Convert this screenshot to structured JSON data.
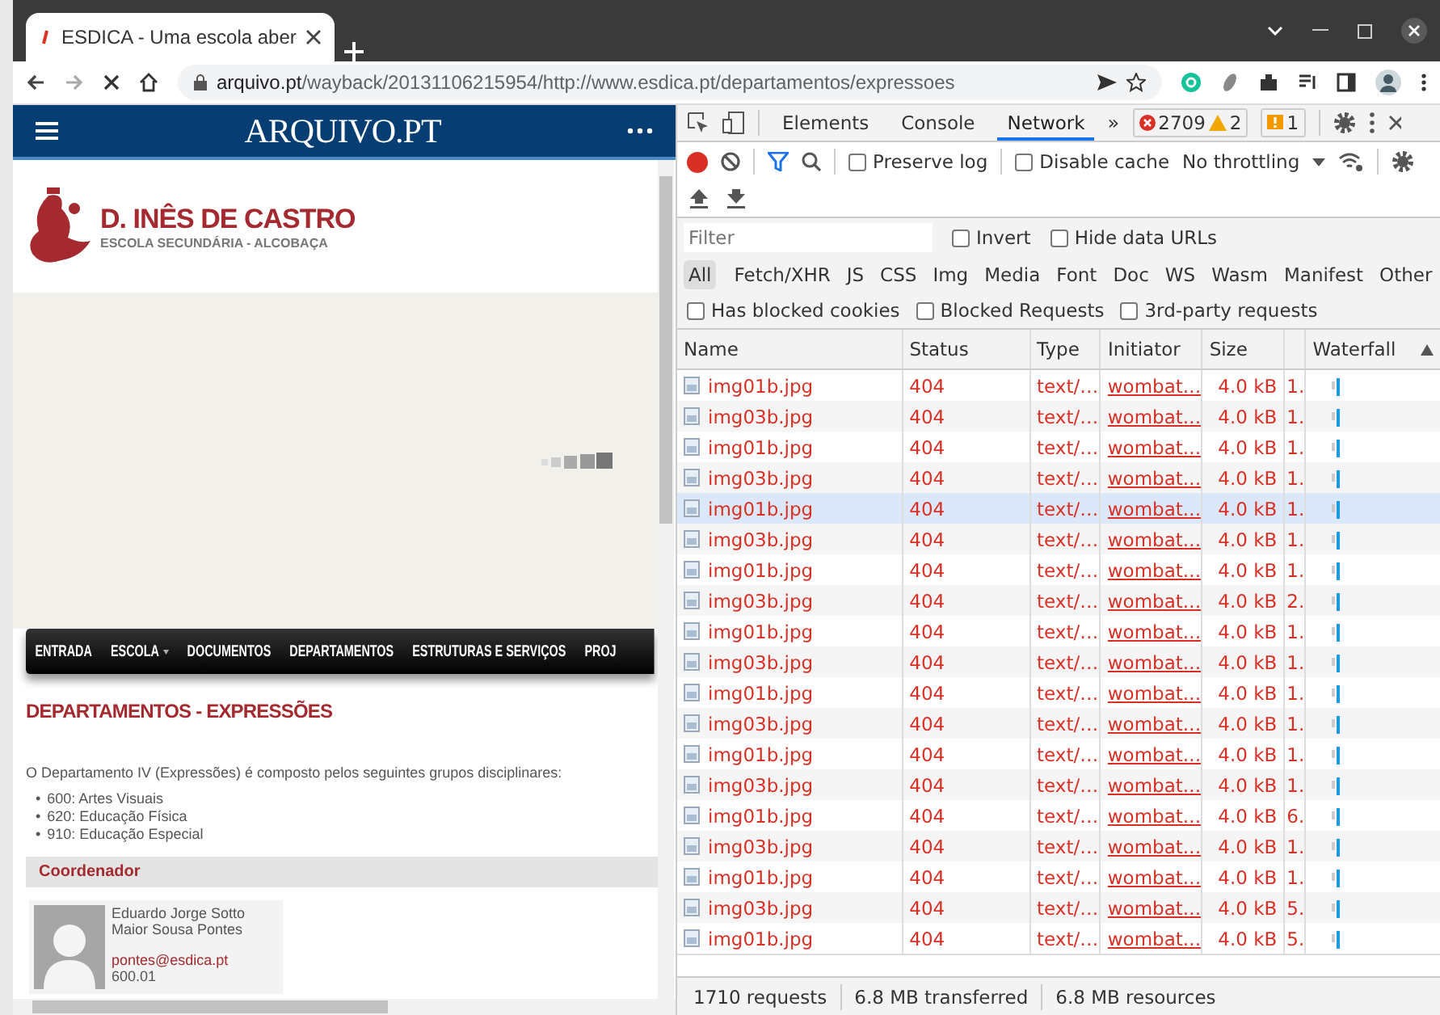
{
  "browser": {
    "tab": {
      "title": "ESDICA - Uma escola aber"
    },
    "url": {
      "host": "arquivo.pt",
      "path": "/wayback/20131106215954/http://www.esdica.pt/departamentos/expressoes"
    }
  },
  "page": {
    "banner": {
      "title": "ARQUIVO.PT"
    },
    "school": {
      "name": "D. INÊS DE CASTRO",
      "subtitle": "ESCOLA SECUNDÁRIA - ALCOBAÇA"
    },
    "nav": [
      {
        "label": "ENTRADA",
        "dropdown": false
      },
      {
        "label": "ESCOLA",
        "dropdown": true
      },
      {
        "label": "DOCUMENTOS",
        "dropdown": false
      },
      {
        "label": "DEPARTAMENTOS",
        "dropdown": false
      },
      {
        "label": "ESTRUTURAS E SERVIÇOS",
        "dropdown": false
      },
      {
        "label": "PROJ",
        "dropdown": false
      }
    ],
    "heading": "DEPARTAMENTOS - EXPRESSÕES",
    "intro": "O Departamento IV (Expressões) é composto pelos seguintes grupos disciplinares:",
    "groups": [
      {
        "marker": "•",
        "text": "600: Artes Visuais"
      },
      {
        "marker": "•",
        "text": "620: Educação Física"
      },
      {
        "marker": "•",
        "text": "910: Educação Especial"
      }
    ],
    "section": "Coordenador",
    "coordinator": {
      "name": "Eduardo Jorge Sotto Maior Sousa Pontes",
      "email": "pontes@esdica.pt",
      "code": "600.01"
    }
  },
  "devtools": {
    "tabs": [
      {
        "label": "Elements",
        "selected": false
      },
      {
        "label": "Console",
        "selected": false
      },
      {
        "label": "Network",
        "selected": true
      }
    ],
    "more": "»",
    "errors": "2709",
    "warnings": "2",
    "issues": "1",
    "options": [
      {
        "label": "Preserve log",
        "checked": false
      },
      {
        "label": "Disable cache",
        "checked": false
      }
    ],
    "throttling": "No throttling",
    "filter": {
      "placeholder": "Filter"
    },
    "filter_options": [
      {
        "label": "Invert",
        "checked": false
      },
      {
        "label": "Hide data URLs",
        "checked": false
      }
    ],
    "types": [
      {
        "label": "All",
        "selected": true
      },
      {
        "label": "Fetch/XHR",
        "selected": false
      },
      {
        "label": "JS",
        "selected": false
      },
      {
        "label": "CSS",
        "selected": false
      },
      {
        "label": "Img",
        "selected": false
      },
      {
        "label": "Media",
        "selected": false
      },
      {
        "label": "Font",
        "selected": false
      },
      {
        "label": "Doc",
        "selected": false
      },
      {
        "label": "WS",
        "selected": false
      },
      {
        "label": "Wasm",
        "selected": false
      },
      {
        "label": "Manifest",
        "selected": false
      },
      {
        "label": "Other",
        "selected": false
      }
    ],
    "blocking": [
      {
        "label": "Has blocked cookies",
        "checked": false
      },
      {
        "label": "Blocked Requests",
        "checked": false
      },
      {
        "label": "3rd-party requests",
        "checked": false
      }
    ],
    "columns": [
      "Name",
      "Status",
      "Type",
      "Initiator",
      "Size",
      "Waterfall"
    ],
    "rows": [
      {
        "name": "img01b.jpg",
        "status": "404",
        "type": "text/…",
        "initiator": "wombat.…",
        "size": "4.0 kB",
        "time": "1.",
        "highlighted": false
      },
      {
        "name": "img03b.jpg",
        "status": "404",
        "type": "text/…",
        "initiator": "wombat.…",
        "size": "4.0 kB",
        "time": "1.",
        "highlighted": false
      },
      {
        "name": "img01b.jpg",
        "status": "404",
        "type": "text/…",
        "initiator": "wombat.…",
        "size": "4.0 kB",
        "time": "1.",
        "highlighted": false
      },
      {
        "name": "img03b.jpg",
        "status": "404",
        "type": "text/…",
        "initiator": "wombat.…",
        "size": "4.0 kB",
        "time": "1.",
        "highlighted": false
      },
      {
        "name": "img01b.jpg",
        "status": "404",
        "type": "text/…",
        "initiator": "wombat.…",
        "size": "4.0 kB",
        "time": "1.",
        "highlighted": true
      },
      {
        "name": "img03b.jpg",
        "status": "404",
        "type": "text/…",
        "initiator": "wombat.…",
        "size": "4.0 kB",
        "time": "1.",
        "highlighted": false
      },
      {
        "name": "img01b.jpg",
        "status": "404",
        "type": "text/…",
        "initiator": "wombat.…",
        "size": "4.0 kB",
        "time": "1.",
        "highlighted": false
      },
      {
        "name": "img03b.jpg",
        "status": "404",
        "type": "text/…",
        "initiator": "wombat.…",
        "size": "4.0 kB",
        "time": "2.",
        "highlighted": false
      },
      {
        "name": "img01b.jpg",
        "status": "404",
        "type": "text/…",
        "initiator": "wombat.…",
        "size": "4.0 kB",
        "time": "1.",
        "highlighted": false
      },
      {
        "name": "img03b.jpg",
        "status": "404",
        "type": "text/…",
        "initiator": "wombat.…",
        "size": "4.0 kB",
        "time": "1.",
        "highlighted": false
      },
      {
        "name": "img01b.jpg",
        "status": "404",
        "type": "text/…",
        "initiator": "wombat.…",
        "size": "4.0 kB",
        "time": "1.",
        "highlighted": false
      },
      {
        "name": "img03b.jpg",
        "status": "404",
        "type": "text/…",
        "initiator": "wombat.…",
        "size": "4.0 kB",
        "time": "1.",
        "highlighted": false
      },
      {
        "name": "img01b.jpg",
        "status": "404",
        "type": "text/…",
        "initiator": "wombat.…",
        "size": "4.0 kB",
        "time": "1.",
        "highlighted": false
      },
      {
        "name": "img03b.jpg",
        "status": "404",
        "type": "text/…",
        "initiator": "wombat.…",
        "size": "4.0 kB",
        "time": "1.",
        "highlighted": false
      },
      {
        "name": "img01b.jpg",
        "status": "404",
        "type": "text/…",
        "initiator": "wombat.…",
        "size": "4.0 kB",
        "time": "6.",
        "highlighted": false
      },
      {
        "name": "img03b.jpg",
        "status": "404",
        "type": "text/…",
        "initiator": "wombat.…",
        "size": "4.0 kB",
        "time": "1.",
        "highlighted": false
      },
      {
        "name": "img01b.jpg",
        "status": "404",
        "type": "text/…",
        "initiator": "wombat.…",
        "size": "4.0 kB",
        "time": "1.",
        "highlighted": false
      },
      {
        "name": "img03b.jpg",
        "status": "404",
        "type": "text/…",
        "initiator": "wombat.…",
        "size": "4.0 kB",
        "time": "5.",
        "highlighted": false
      },
      {
        "name": "img01b.jpg",
        "status": "404",
        "type": "text/…",
        "initiator": "wombat.…",
        "size": "4.0 kB",
        "time": "5.",
        "highlighted": false
      }
    ],
    "summary": [
      "1710 requests",
      "6.8 MB transferred",
      "6.8 MB resources"
    ]
  }
}
